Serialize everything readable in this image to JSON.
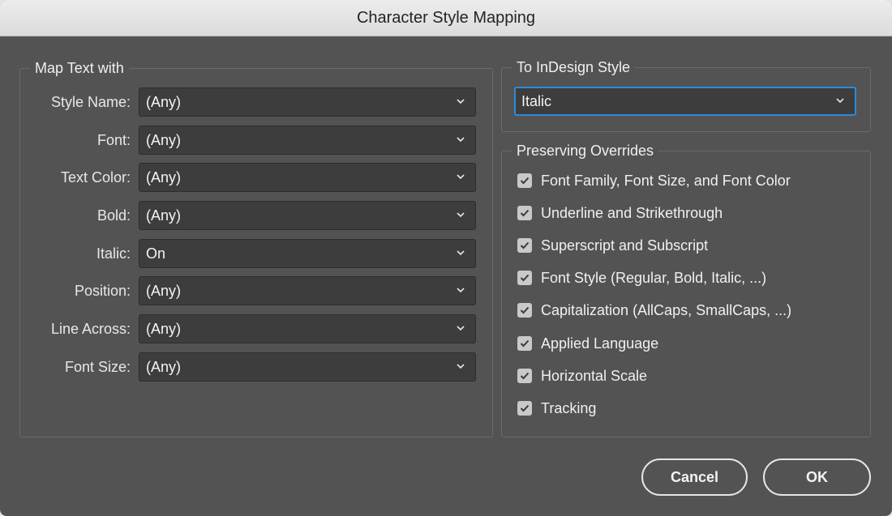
{
  "dialog": {
    "title": "Character Style Mapping"
  },
  "map_text": {
    "legend": "Map Text with",
    "rows": [
      {
        "label": "Style Name:",
        "value": "(Any)"
      },
      {
        "label": "Font:",
        "value": "(Any)"
      },
      {
        "label": "Text Color:",
        "value": "(Any)"
      },
      {
        "label": "Bold:",
        "value": "(Any)"
      },
      {
        "label": "Italic:",
        "value": "On"
      },
      {
        "label": "Position:",
        "value": "(Any)"
      },
      {
        "label": "Line Across:",
        "value": "(Any)"
      },
      {
        "label": "Font Size:",
        "value": "(Any)"
      }
    ]
  },
  "to_indesign": {
    "legend": "To InDesign Style",
    "value": "Italic"
  },
  "overrides": {
    "legend": "Preserving Overrides",
    "items": [
      {
        "label": "Font Family, Font Size, and Font Color",
        "checked": true
      },
      {
        "label": "Underline and Strikethrough",
        "checked": true
      },
      {
        "label": "Superscript and Subscript",
        "checked": true
      },
      {
        "label": "Font Style (Regular, Bold, Italic, ...)",
        "checked": true
      },
      {
        "label": "Capitalization (AllCaps, SmallCaps, ...)",
        "checked": true
      },
      {
        "label": "Applied Language",
        "checked": true
      },
      {
        "label": "Horizontal Scale",
        "checked": true
      },
      {
        "label": "Tracking",
        "checked": true
      }
    ]
  },
  "buttons": {
    "cancel_label": "Cancel",
    "ok_label": "OK"
  },
  "colors": {
    "dialog_bg": "#535353",
    "field_bg": "#3d3d3d",
    "focus_ring": "#2b8cde",
    "checkbox_bg": "#c9c9c9"
  }
}
